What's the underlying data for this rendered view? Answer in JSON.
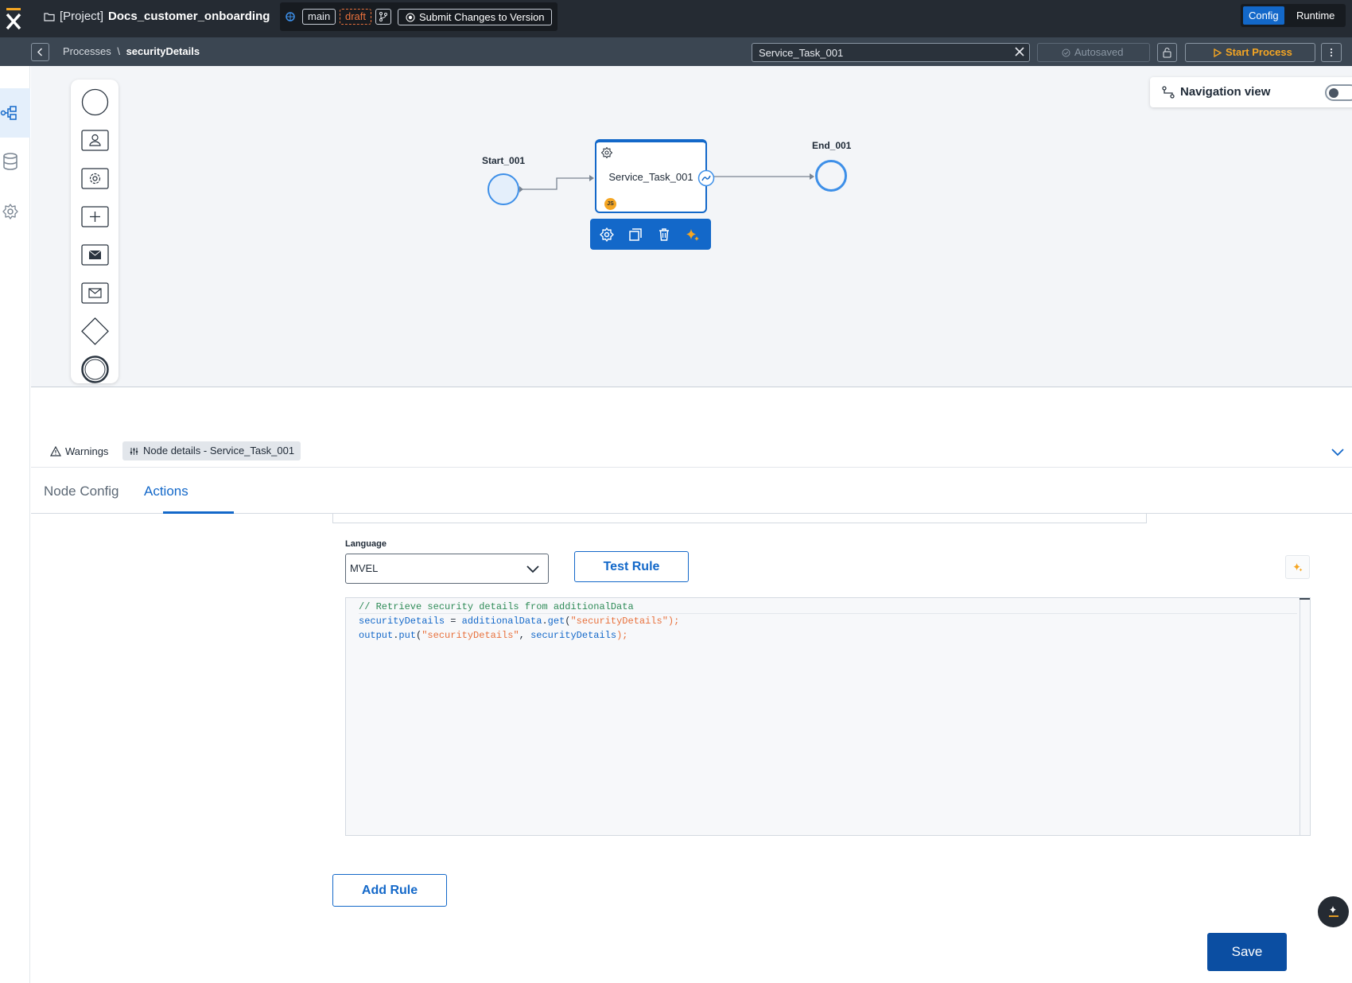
{
  "topbar": {
    "project_prefix": "[Project]",
    "project_name": "Docs_customer_onboarding",
    "branch": "main",
    "status": "draft",
    "submit_label": "Submit Changes to Version",
    "mode_config": "Config",
    "mode_runtime": "Runtime"
  },
  "subbar": {
    "crumb_root": "Processes",
    "crumb_sep": "\\",
    "crumb_current": "securityDetails",
    "search_value": "Service_Task_001",
    "autosave": "Autosaved",
    "start_label": "Start Process"
  },
  "canvas": {
    "navigation_view_label": "Navigation view",
    "navigation_view_on": false,
    "start_node": "Start_001",
    "task_node": "Service_Task_001",
    "end_node": "End_001",
    "task_badge": "JS"
  },
  "panel": {
    "warnings_label": "Warnings",
    "node_details_label": "Node details - Service_Task_001",
    "tabs": [
      {
        "label": "Node Config",
        "active": false
      },
      {
        "label": "Actions",
        "active": true
      }
    ],
    "language_label": "Language",
    "language_value": "MVEL",
    "test_rule_label": "Test Rule",
    "code": {
      "line1": "// Retrieve security details from additionalData",
      "line2_a": "securityDetails",
      "line2_b": " = ",
      "line2_c": "additionalData",
      "line2_d": ".",
      "line2_e": "get",
      "line2_f": "(",
      "line2_g": "\"securityDetails\"",
      "line2_h": ");",
      "line3_a": "output",
      "line3_b": ".",
      "line3_c": "put",
      "line3_d": "(",
      "line3_e": "\"securityDetails\"",
      "line3_f": ", ",
      "line3_g": "securityDetails",
      "line3_h": ");"
    },
    "add_rule_label": "Add Rule",
    "save_label": "Save"
  },
  "colors": {
    "accent": "#1368c9",
    "topbar": "#252b33",
    "draft": "#e8713c",
    "start_process": "#f5a623"
  }
}
